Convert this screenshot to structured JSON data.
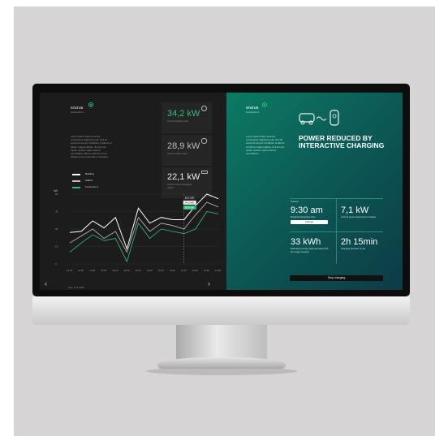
{
  "left": {
    "status_label": "STATUS",
    "connector": "Connector 1",
    "description": "Lorem ipsum dolor sit amet, consectetur adipiscing elit, sed do eiusmod tempor incididunt ut labore et dolore magna aliqua. Ut enim ad minim veniam, quis nostrud exercitation ullamco laboris nisi ut aliquip ex ea commodo consequat.",
    "cards": [
      {
        "value": "34,2 kW",
        "label": "Current building load",
        "icon": "cloud-icon"
      },
      {
        "value": "28,9 kW",
        "label": "Current station load",
        "icon": "plug-icon"
      },
      {
        "value": "22,1 kW",
        "label": "Current load of charging station",
        "icon": "connector-icon"
      }
    ],
    "legend": [
      {
        "label": "Building",
        "color": "#ffffff"
      },
      {
        "label": "Station",
        "color": "#bdbdbd"
      },
      {
        "label": "Connector 1",
        "color": "#2fbf7a"
      }
    ]
  },
  "chart_data": {
    "type": "line",
    "ylabel": "kW",
    "yticks": [
      "60",
      "45",
      "30",
      "15",
      "0"
    ],
    "x": [
      "14:15",
      "13:30",
      "13:45",
      "13:00",
      "12:15",
      "12:30",
      "12:45",
      "13:00",
      "13:15",
      "14:00",
      "14:15",
      "13:30",
      "13:45",
      "14:00"
    ],
    "date": "Tue, 17.1.2017",
    "tooltip": [
      "22,1 kW",
      "34,2 kW",
      "28,9 kW"
    ],
    "series": [
      {
        "name": "Building",
        "values": [
          27,
          28,
          37,
          31,
          40,
          13,
          48,
          35,
          40,
          38,
          38,
          50,
          60,
          56
        ]
      },
      {
        "name": "Station",
        "values": [
          18,
          24,
          30,
          22,
          28,
          10,
          40,
          28,
          35,
          33,
          30,
          42,
          53,
          49
        ]
      },
      {
        "name": "Connector 1",
        "values": [
          10,
          18,
          25,
          20,
          22,
          2,
          35,
          22,
          30,
          28,
          26,
          30,
          45,
          43
        ]
      }
    ]
  },
  "right": {
    "status_label": "STATUS",
    "connector": "Connector 1",
    "description": "Lorem ipsum dolor sit amet, consectetur adipiscing elit, sed do eiusmod tempor incididunt ut labore et dolore magna aliqua. Ut enim ad minim veniam, quis nostrud exercitation.",
    "title": "POWER REDUCED BY INTERACTIVE CHARGING",
    "session_label": "Session",
    "time": "9:30 am",
    "time_label": "Predicted departure time",
    "change_button": "Change",
    "power": "7,1 kW",
    "power_label": "Current power delivered to charger",
    "energy": "33 kWh",
    "energy_label": "Estimated energy (approximately 200 km range needed)",
    "duration": "2h 15min",
    "duration_label": "Charging duration so far",
    "stop_button": "Stop charging"
  }
}
